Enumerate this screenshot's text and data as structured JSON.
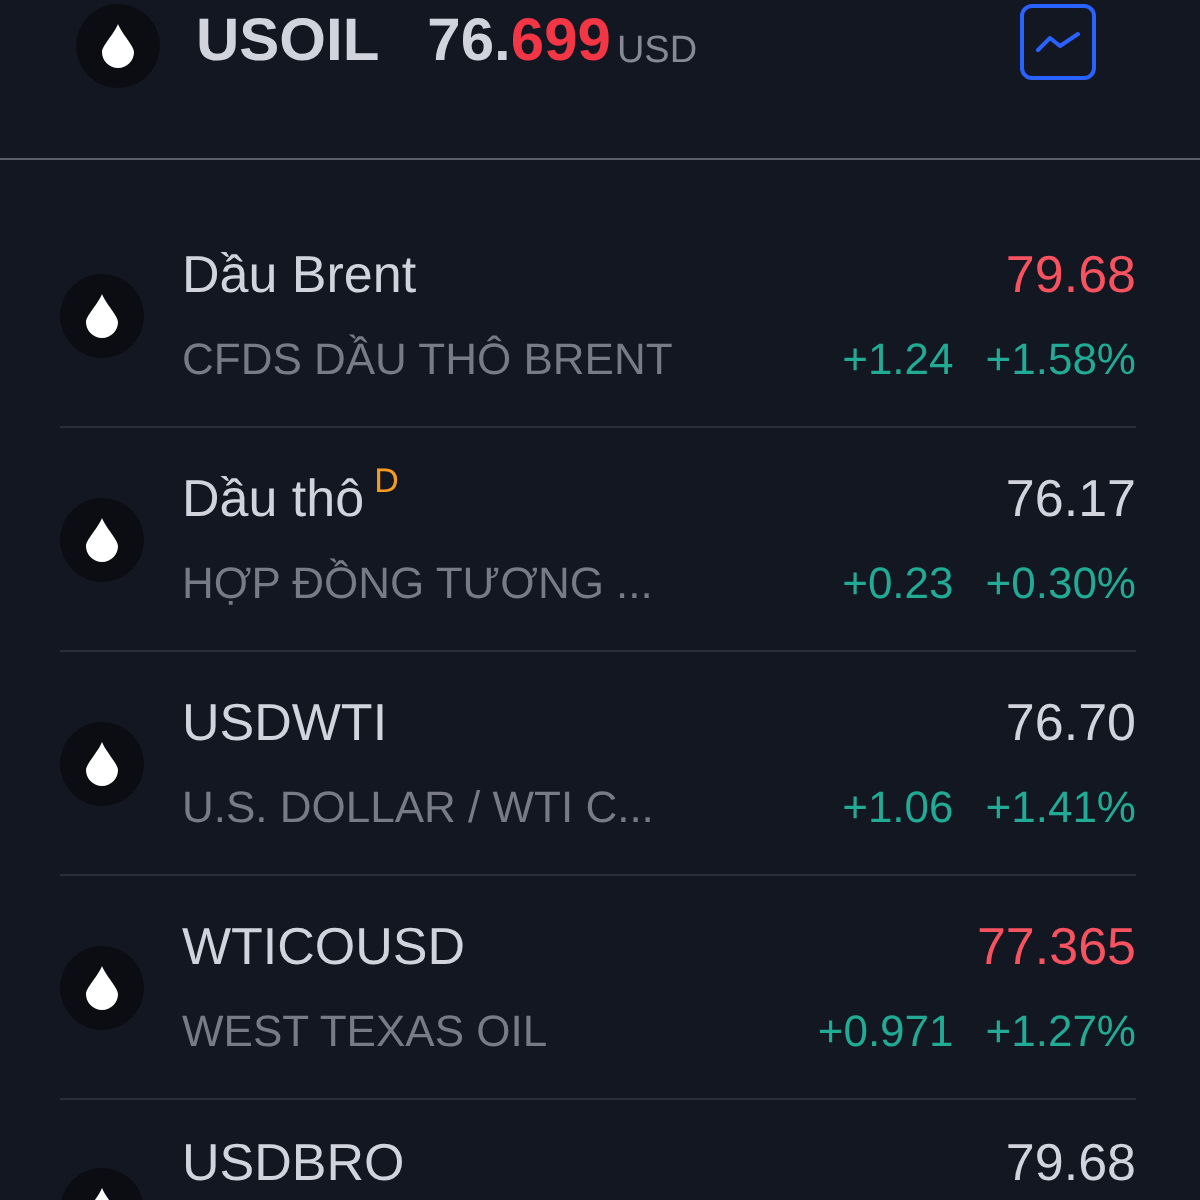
{
  "header": {
    "symbol": "USOIL",
    "price_main": "76.",
    "price_flash": "699",
    "price_down": true,
    "currency": "USD",
    "chart_button": {
      "selected": true
    }
  },
  "related": [
    {
      "name": "Dầu Brent",
      "description": "CFDS DẦU THÔ BRENT",
      "price": "79.68",
      "price_down": true,
      "change": "+1.24",
      "change_pct": "+1.58%"
    },
    {
      "name": "Dầu thô",
      "badge": "D",
      "description": "HỢP ĐỒNG TƯƠNG ...",
      "price": "76.17",
      "price_down": false,
      "change": "+0.23",
      "change_pct": "+0.30%"
    },
    {
      "name": "USDWTI",
      "description": "U.S. DOLLAR / WTI C...",
      "price": "76.70",
      "price_down": false,
      "change": "+1.06",
      "change_pct": "+1.41%"
    },
    {
      "name": "WTICOUSD",
      "description": "WEST TEXAS OIL",
      "price": "77.365",
      "price_down": true,
      "change": "+0.971",
      "change_pct": "+1.27%"
    },
    {
      "name": "USDBRO",
      "price": "79.68",
      "price_down": false
    }
  ]
}
